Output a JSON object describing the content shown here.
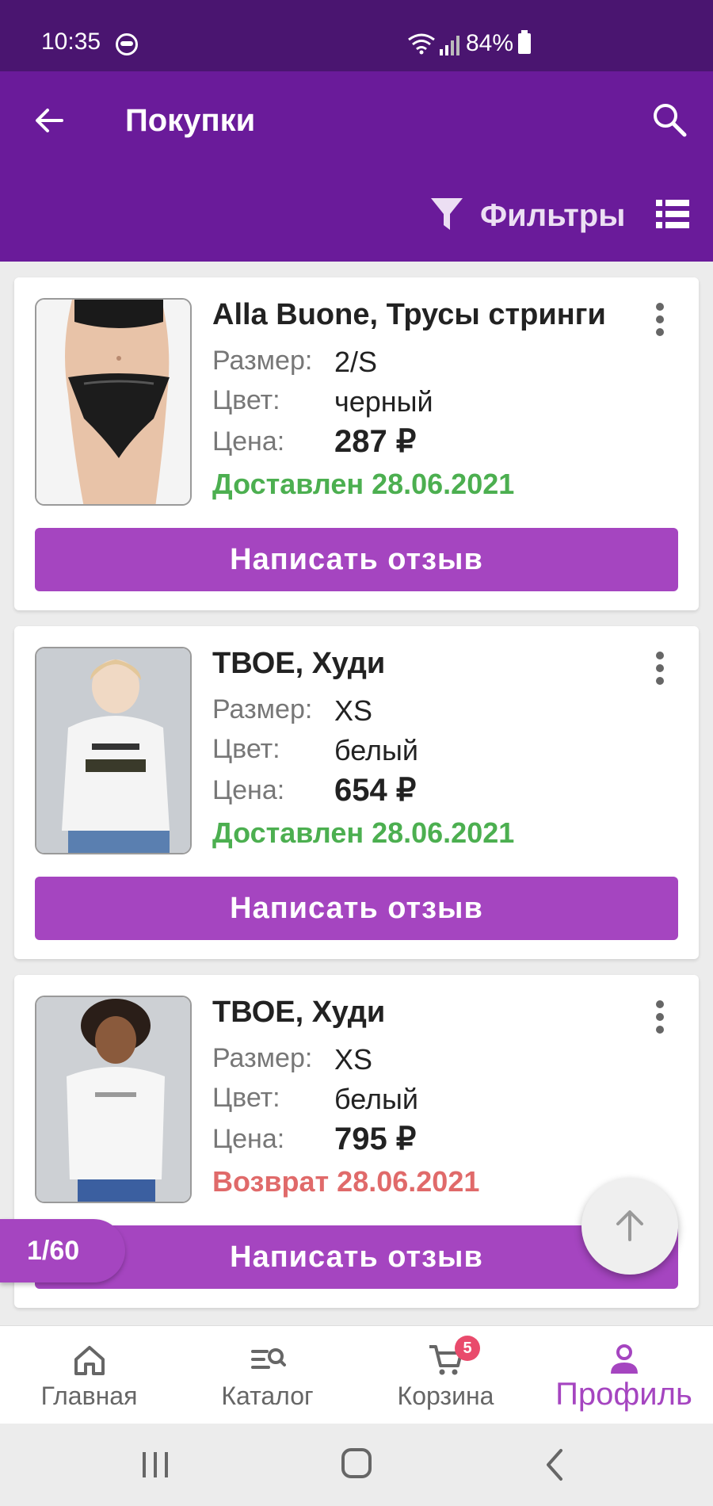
{
  "status_bar": {
    "time": "10:35",
    "battery": "84%"
  },
  "header": {
    "title": "Покупки",
    "filters_label": "Фильтры"
  },
  "labels": {
    "size": "Размер:",
    "color": "Цвет:",
    "price": "Цена:",
    "review_button": "Написать отзыв"
  },
  "orders": [
    {
      "title": "Alla Buone, Трусы стринги",
      "size": "2/S",
      "color": "черный",
      "price": "287 ₽",
      "status": "Доставлен 28.06.2021",
      "status_type": "delivered"
    },
    {
      "title": "ТВОЕ, Худи",
      "size": "XS",
      "color": "белый",
      "price": "654 ₽",
      "status": "Доставлен 28.06.2021",
      "status_type": "delivered"
    },
    {
      "title": "ТВОЕ, Худи",
      "size": "XS",
      "color": "белый",
      "price": "795 ₽",
      "status": "Возврат 28.06.2021",
      "status_type": "returned"
    }
  ],
  "pagination": {
    "counter": "1/60"
  },
  "bottom_nav": {
    "items": [
      {
        "label": "Главная",
        "icon": "home-icon"
      },
      {
        "label": "Каталог",
        "icon": "catalog-search-icon"
      },
      {
        "label": "Корзина",
        "icon": "cart-icon",
        "badge": "5"
      },
      {
        "label": "Профиль",
        "icon": "profile-icon",
        "active": true
      }
    ]
  },
  "colors": {
    "status_bar": "#4a1570",
    "app_bar": "#6a1b9a",
    "accent": "#a545c0",
    "delivered": "#4caf50",
    "returned": "#e06a6a",
    "badge": "#e94b6c"
  }
}
